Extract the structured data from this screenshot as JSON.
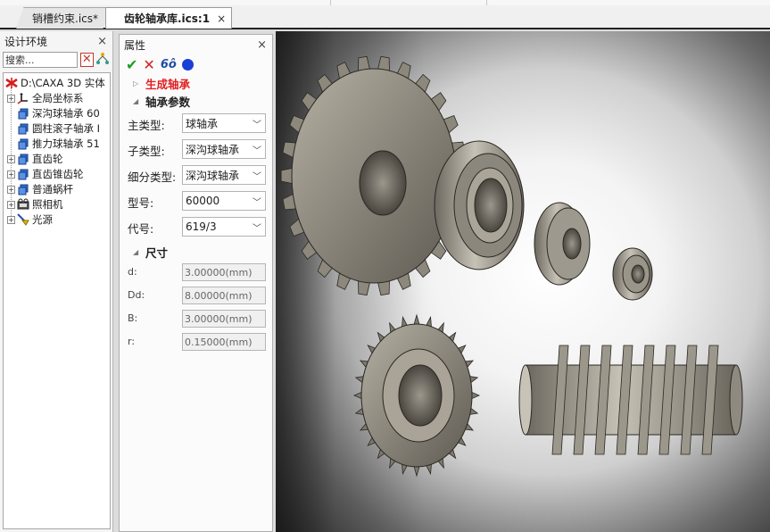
{
  "tabs": [
    {
      "label": "销槽约束.ics*",
      "active": false
    },
    {
      "label": "齿轮轴承库.ics:1",
      "active": true,
      "close": "×"
    }
  ],
  "design_env": {
    "title": "设计环境",
    "close": "×",
    "search_placeholder": "搜索...",
    "tree": [
      {
        "label": "D:\\CAXA 3D 实体",
        "icon": "caxa-logo-icon",
        "level": 0
      },
      {
        "label": "全局坐标系",
        "icon": "coordinate-system-icon",
        "level": 1
      },
      {
        "label": "深沟球轴承 60",
        "icon": "part-icon",
        "level": 1
      },
      {
        "label": "圆柱滚子轴承 I",
        "icon": "part-icon",
        "level": 1
      },
      {
        "label": "推力球轴承 51",
        "icon": "part-icon",
        "level": 1
      },
      {
        "label": "直齿轮",
        "icon": "part-icon",
        "level": 1
      },
      {
        "label": "直齿锥齿轮",
        "icon": "part-icon",
        "level": 1
      },
      {
        "label": "普通蜗杆",
        "icon": "part-icon",
        "level": 1
      },
      {
        "label": "照相机",
        "icon": "camera-icon",
        "level": 1
      },
      {
        "label": "光源",
        "icon": "light-icon",
        "level": 1
      }
    ]
  },
  "props": {
    "title": "属性",
    "close": "×",
    "toolbar": {
      "ok": "✔",
      "cancel": "✕",
      "glasses": "6ô"
    },
    "generate": {
      "title": "生成轴承",
      "tri": "▷"
    },
    "bearing_params": {
      "title": "轴承参数",
      "tri": "◢"
    },
    "fields": [
      {
        "label": "主类型:",
        "value": "球轴承"
      },
      {
        "label": "子类型:",
        "value": "深沟球轴承"
      },
      {
        "label": "细分类型:",
        "value": "深沟球轴承"
      },
      {
        "label": "型号:",
        "value": "60000"
      },
      {
        "label": "代号:",
        "value": "619/3"
      }
    ],
    "dimensions": {
      "title": "尺寸",
      "tri": "◢"
    },
    "dims": [
      {
        "label": "d:",
        "value": "3.00000(mm)"
      },
      {
        "label": "Dd:",
        "value": "8.00000(mm)"
      },
      {
        "label": "B:",
        "value": "3.00000(mm)"
      },
      {
        "label": "r:",
        "value": "0.15000(mm)"
      }
    ]
  },
  "colors": {
    "accent_red": "#e02020",
    "ok_green": "#1e9e1e",
    "metal": "#8a857a"
  }
}
